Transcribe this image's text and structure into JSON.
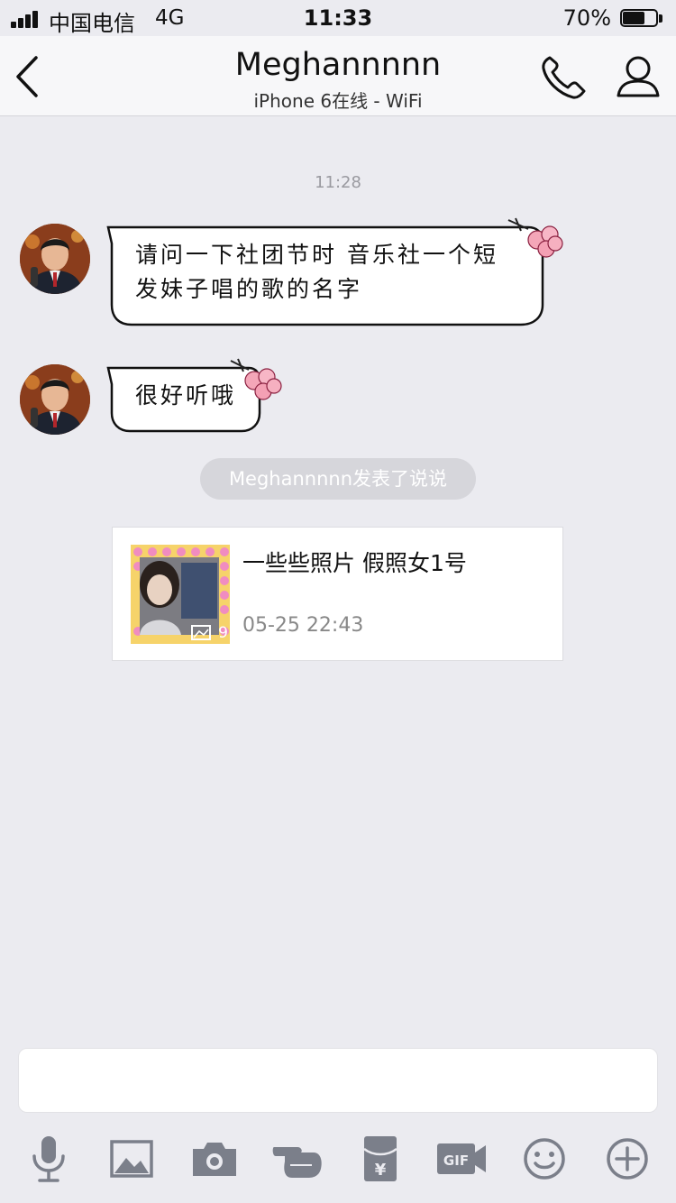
{
  "status_bar": {
    "carrier": "中国电信",
    "network": "4G",
    "time": "11:33",
    "battery_percent": "70%",
    "battery_level": 0.7
  },
  "nav": {
    "title": "Meghannnnn",
    "subtitle": "iPhone 6在线 - WiFi"
  },
  "chat": {
    "timestamp": "11:28",
    "messages": [
      {
        "lines": [
          "请问一下社团节时 音乐社一个短",
          "发妹子唱的歌的名字"
        ]
      },
      {
        "lines": [
          "很好听哦"
        ]
      }
    ],
    "system_notice": "Meghannnnn发表了说说"
  },
  "post_card": {
    "title": "一些些照片  假照女1号",
    "date": "05-25 22:43",
    "photo_count": "9"
  },
  "input": {
    "value": ""
  },
  "toolbar": [
    "microphone-icon",
    "image-icon",
    "camera-icon",
    "poke-icon",
    "red-envelope-icon",
    "gif-icon",
    "emoji-icon",
    "plus-icon"
  ],
  "colors": {
    "background": "#ebebf0",
    "navbar": "#f7f7f9",
    "icon": "#7b7f8a",
    "pill": "#d6d6db"
  }
}
